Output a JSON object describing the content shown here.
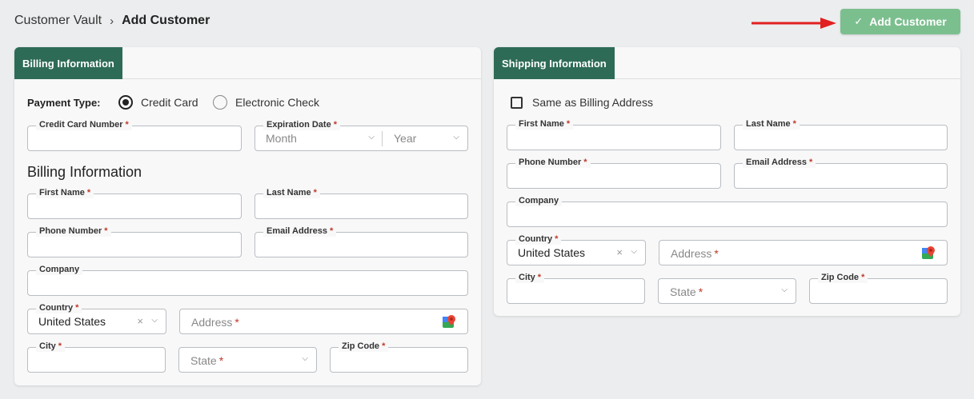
{
  "breadcrumb": {
    "root": "Customer Vault",
    "separator": "›",
    "current": "Add Customer"
  },
  "header": {
    "add_button": "Add Customer",
    "add_icon": "check-icon"
  },
  "billing": {
    "tab": "Billing Information",
    "payment_type_label": "Payment Type:",
    "payment_options": [
      {
        "label": "Credit Card",
        "selected": true
      },
      {
        "label": "Electronic Check",
        "selected": false
      }
    ],
    "credit_card_number_label": "Credit Card Number",
    "expiration_label": "Expiration Date",
    "month_placeholder": "Month",
    "year_placeholder": "Year",
    "section_title": "Billing Information",
    "first_name_label": "First Name",
    "last_name_label": "Last Name",
    "phone_label": "Phone Number",
    "email_label": "Email Address",
    "company_label": "Company",
    "country_label": "Country",
    "country_value": "United States",
    "address_placeholder": "Address",
    "city_label": "City",
    "state_placeholder": "State",
    "zip_label": "Zip Code"
  },
  "shipping": {
    "tab": "Shipping Information",
    "same_as_billing": "Same as Billing Address",
    "same_as_billing_checked": false,
    "first_name_label": "First Name",
    "last_name_label": "Last Name",
    "phone_label": "Phone Number",
    "email_label": "Email Address",
    "company_label": "Company",
    "country_label": "Country",
    "country_value": "United States",
    "address_placeholder": "Address",
    "city_label": "City",
    "state_placeholder": "State",
    "zip_label": "Zip Code"
  },
  "required_marker": "*",
  "colors": {
    "tab_bg": "#2e6b57",
    "button_bg": "#7cbf8f",
    "required": "#c0392b",
    "arrow": "#e02020"
  }
}
